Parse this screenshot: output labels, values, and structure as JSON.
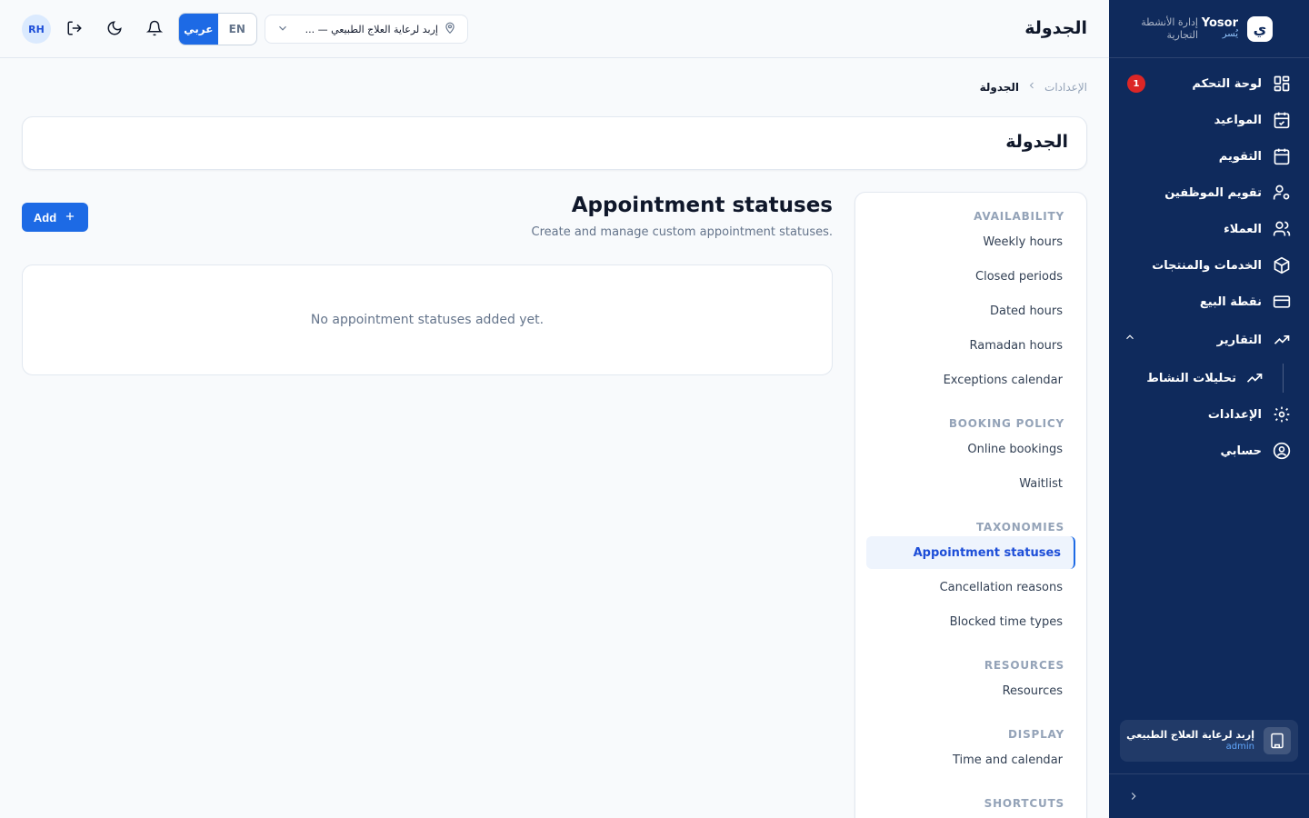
{
  "colors": {
    "sidebar_bg": "#0f2a5c",
    "primary": "#1d6ae5",
    "badge": "#dc2626",
    "active_item_bg": "#eef4fd"
  },
  "brand": {
    "name_en": "Yosor",
    "name_ar": "يُسر",
    "subtitle": "إدارة الأنشطة التجارية",
    "logo_glyph": "ي"
  },
  "sidebar": {
    "items": [
      {
        "label": "لوحة التحكم",
        "icon": "dashboard-icon",
        "badge": "1"
      },
      {
        "label": "المواعيد",
        "icon": "calendar-check-icon"
      },
      {
        "label": "التقويم",
        "icon": "calendar-icon"
      },
      {
        "label": "تقويم الموظفين",
        "icon": "user-cog-icon"
      },
      {
        "label": "العملاء",
        "icon": "users-icon"
      },
      {
        "label": "الخدمات والمنتجات",
        "icon": "package-icon"
      },
      {
        "label": "نقطة البيع",
        "icon": "credit-card-icon"
      },
      {
        "label": "التقارير",
        "icon": "trending-up-icon",
        "expanded": true
      },
      {
        "label": "تحليلات النشاط",
        "icon": "trending-up-icon",
        "sub": true
      },
      {
        "label": "الإعدادات",
        "icon": "settings-icon"
      },
      {
        "label": "حسابي",
        "icon": "user-circle-icon"
      }
    ],
    "org": {
      "name": "إربد لرعاية العلاج الطبيعي",
      "role": "admin"
    }
  },
  "topbar": {
    "page_title": "الجدولة",
    "avatar_initials": "RH",
    "lang_ar": "عربي",
    "lang_en": "EN",
    "location": "إربد لرعاية العلاج الطبيعي — ..."
  },
  "breadcrumb": {
    "parent": "الإعدادات",
    "current": "الجدولة"
  },
  "header_card": {
    "title": "الجدولة"
  },
  "settings_nav": {
    "groups": [
      {
        "title": "AVAILABILITY",
        "items": [
          "Weekly hours",
          "Closed periods",
          "Dated hours",
          "Ramadan hours",
          "Exceptions calendar"
        ]
      },
      {
        "title": "BOOKING POLICY",
        "items": [
          "Online bookings",
          "Waitlist"
        ]
      },
      {
        "title": "TAXONOMIES",
        "items": [
          "Appointment statuses",
          "Cancellation reasons",
          "Blocked time types"
        ]
      },
      {
        "title": "RESOURCES",
        "items": [
          "Resources"
        ]
      },
      {
        "title": "DISPLAY",
        "items": [
          "Time and calendar"
        ]
      },
      {
        "title": "SHORTCUTS",
        "items": []
      }
    ],
    "active_item": "Appointment statuses"
  },
  "main": {
    "title": "Appointment statuses",
    "description": "Create and manage custom appointment statuses.",
    "add_label": "Add",
    "empty_text": "No appointment statuses added yet."
  }
}
